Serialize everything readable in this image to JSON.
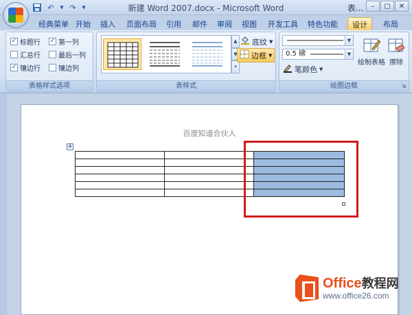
{
  "window": {
    "title": "新建 Word 2007.docx - Microsoft Word",
    "context_label": "表...",
    "controls": [
      "–",
      "▢",
      "✕"
    ]
  },
  "qat": {
    "save_icon": "save-icon",
    "undo_icon": "undo-icon",
    "redo_icon": "redo-icon"
  },
  "tabs": [
    {
      "label": "经典菜单"
    },
    {
      "label": "开始"
    },
    {
      "label": "插入"
    },
    {
      "label": "页面布局"
    },
    {
      "label": "引用"
    },
    {
      "label": "邮件"
    },
    {
      "label": "审阅"
    },
    {
      "label": "视图"
    },
    {
      "label": "开发工具"
    },
    {
      "label": "特色功能"
    },
    {
      "label": "设计",
      "active": true
    },
    {
      "label": "布局"
    }
  ],
  "ribbon": {
    "table_style_options": {
      "label": "表格样式选项",
      "options": [
        {
          "label": "标题行",
          "checked": true
        },
        {
          "label": "第一列",
          "checked": true
        },
        {
          "label": "汇总行",
          "checked": false
        },
        {
          "label": "最后一列",
          "checked": false
        },
        {
          "label": "镶边行",
          "checked": true
        },
        {
          "label": "镶边列",
          "checked": false
        }
      ]
    },
    "table_styles": {
      "label": "表样式",
      "shading_label": "底纹",
      "borders_label": "边框"
    },
    "draw_borders": {
      "label": "绘图边框",
      "pen_weight": "0.5 磅",
      "pen_color_label": "笔颜色",
      "draw_table_label": "绘制表格",
      "eraser_label": "擦除"
    }
  },
  "document": {
    "header_text": "百度知道合伙人",
    "table_rows": 6,
    "table_cols": 3,
    "selected_column": 3
  },
  "watermark": {
    "brand": "Office",
    "brand_cn": "教程网",
    "url": "www.office26.com"
  },
  "colors": {
    "accent": "#f6cf72",
    "selection": "#9bbbe0",
    "annotation": "#d11a1a",
    "watermark": "#e8501c"
  }
}
